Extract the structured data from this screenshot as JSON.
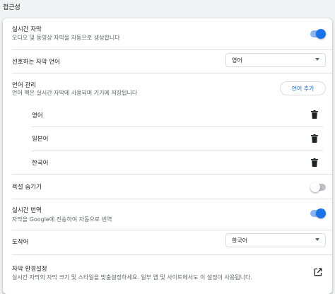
{
  "section_title": "접근성",
  "live_caption": {
    "title": "실시간 자막",
    "desc": "오디오 및 동영상 자막을 자동으로 생성합니다",
    "enabled": true
  },
  "preferred_language": {
    "label": "선호하는 자막 언어",
    "value": "영어"
  },
  "language_management": {
    "title": "언어 관리",
    "desc": "언어 팩은 실시간 자막에 사용되며 기기에 저장됩니다",
    "add_button": "언어 추가",
    "languages": [
      "영어",
      "일본어",
      "한국어"
    ],
    "icon": "trash-icon"
  },
  "hide_profanity": {
    "label": "욕설 숨기기",
    "enabled": false
  },
  "live_translate": {
    "title": "실시간 번역",
    "desc": "자막을 Google에 전송하여 자동으로 번역",
    "enabled": true
  },
  "target_language": {
    "label": "도착어",
    "value": "한국어"
  },
  "caption_preferences": {
    "title": "자막 환경설정",
    "desc": "실시간 자막의 자막 크기 및 스타일을 맞춤설정하세요. 일부 앱 및 사이트에서도 이 설정이 사용됩니다.",
    "icon": "external-link-icon"
  },
  "colors": {
    "accent": "#1a73e8",
    "toggle_track_on": "#8ab4f8",
    "toggle_track_off": "#bdc1c6"
  }
}
